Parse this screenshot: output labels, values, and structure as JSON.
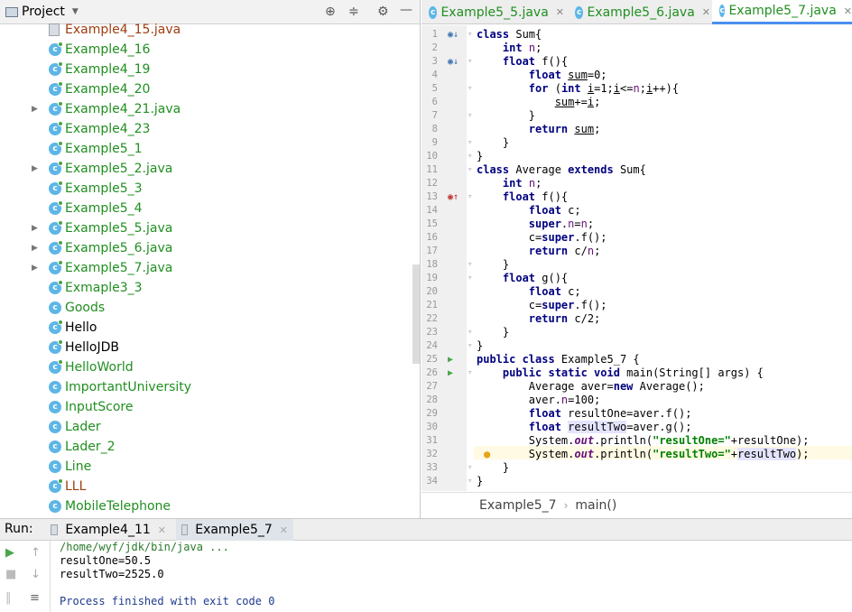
{
  "project": {
    "title": "Project"
  },
  "tree": [
    {
      "label": "Example4_15.java",
      "color": "brown",
      "icon": "file",
      "arrow": false
    },
    {
      "label": "Example4_16",
      "color": "green",
      "icon": "class-run",
      "arrow": false
    },
    {
      "label": "Example4_19",
      "color": "green",
      "icon": "class-run",
      "arrow": false
    },
    {
      "label": "Example4_20",
      "color": "green",
      "icon": "class-run",
      "arrow": false
    },
    {
      "label": "Example4_21.java",
      "color": "green",
      "icon": "class-run",
      "arrow": true
    },
    {
      "label": "Example4_23",
      "color": "green",
      "icon": "class-run",
      "arrow": false
    },
    {
      "label": "Example5_1",
      "color": "green",
      "icon": "class-run",
      "arrow": false
    },
    {
      "label": "Example5_2.java",
      "color": "green",
      "icon": "class-run",
      "arrow": true
    },
    {
      "label": "Example5_3",
      "color": "green",
      "icon": "class-run",
      "arrow": false
    },
    {
      "label": "Example5_4",
      "color": "green",
      "icon": "class-run",
      "arrow": false
    },
    {
      "label": "Example5_5.java",
      "color": "green",
      "icon": "class-run",
      "arrow": true
    },
    {
      "label": "Example5_6.java",
      "color": "green",
      "icon": "class-run",
      "arrow": true
    },
    {
      "label": "Example5_7.java",
      "color": "green",
      "icon": "class-run",
      "arrow": true
    },
    {
      "label": "Exmaple3_3",
      "color": "green",
      "icon": "class-run",
      "arrow": false
    },
    {
      "label": "Goods",
      "color": "green",
      "icon": "class",
      "arrow": false
    },
    {
      "label": "Hello",
      "color": "black",
      "icon": "class-run",
      "arrow": false
    },
    {
      "label": "HelloJDB",
      "color": "black",
      "icon": "class-run",
      "arrow": false
    },
    {
      "label": "HelloWorld",
      "color": "green",
      "icon": "class-run",
      "arrow": false
    },
    {
      "label": "ImportantUniversity",
      "color": "green",
      "icon": "class",
      "arrow": false
    },
    {
      "label": "InputScore",
      "color": "green",
      "icon": "class",
      "arrow": false
    },
    {
      "label": "Lader",
      "color": "green",
      "icon": "class",
      "arrow": false
    },
    {
      "label": "Lader_2",
      "color": "green",
      "icon": "class",
      "arrow": false
    },
    {
      "label": "Line",
      "color": "green",
      "icon": "class",
      "arrow": false
    },
    {
      "label": "LLL",
      "color": "brown",
      "icon": "class-run",
      "arrow": false
    },
    {
      "label": "MobileTelephone",
      "color": "green",
      "icon": "class",
      "arrow": false
    }
  ],
  "tabs": [
    "Example5_5.java",
    "Example5_6.java",
    "Example5_7.java"
  ],
  "code_lines": [
    "<span class=\"kw\">class</span> Sum{",
    "    <span class=\"kw\">int</span> <span class=\"fld\">n</span>;",
    "    <span class=\"kw\">float</span> f(){",
    "        <span class=\"kw\">float</span> <span class=\"ul\">sum</span>=0;",
    "        <span class=\"kw\">for</span> (<span class=\"kw\">int</span> <span class=\"ul\">i</span>=1;<span class=\"ul\">i</span>&lt;=<span class=\"fld\">n</span>;<span class=\"ul\">i</span>++){",
    "            <span class=\"ul\">sum</span>+=<span class=\"ul\">i</span>;",
    "        }",
    "        <span class=\"kw\">return</span> <span class=\"ul\">sum</span>;",
    "    }",
    "}",
    "<span class=\"kw\">class</span> Average <span class=\"kw\">extends</span> Sum{",
    "    <span class=\"kw\">int</span> <span class=\"fld\">n</span>;",
    "    <span class=\"kw\">float</span> f(){",
    "        <span class=\"kw\">float</span> c;",
    "        <span class=\"kw\">super</span>.<span class=\"fld\">n</span>=<span class=\"fld\">n</span>;",
    "        c=<span class=\"kw\">super</span>.f();",
    "        <span class=\"kw\">return</span> c/<span class=\"fld\">n</span>;",
    "    }",
    "    <span class=\"kw\">float</span> g(){",
    "        <span class=\"kw\">float</span> c;",
    "        c=<span class=\"kw\">super</span>.f();",
    "        <span class=\"kw\">return</span> c/2;",
    "    }",
    "}",
    "<span class=\"kw\">public class</span> Example5_7 {",
    "    <span class=\"kw\">public static void</span> main(String[] args) {",
    "        Average aver=<span class=\"kw\">new</span> Average();",
    "        aver.<span class=\"fld\">n</span>=100;",
    "        <span class=\"kw\">float</span> resultOne=aver.f();",
    "        <span class=\"kw\">float</span> <span class=\"hl\">resultTwo</span>=aver.g();",
    "        System.<span class=\"ital\">out</span>.println(<span class=\"str\">\"resultOne=\"</span>+resultOne);",
    "        System.<span class=\"ital\">out</span>.println(<span class=\"str\">\"resultTwo=\"</span>+<span class=\"hl\">resultTwo</span>);",
    "    }",
    "}"
  ],
  "breadcrumb": {
    "cls": "Example5_7",
    "method": "main()"
  },
  "run": {
    "label": "Run:",
    "tabs": [
      "Example4_11",
      "Example5_7"
    ]
  },
  "console": {
    "cmd": "/home/wyf/jdk/bin/java ...",
    "out1": "resultOne=50.5",
    "out2": "resultTwo=2525.0",
    "done": "Process finished with exit code 0"
  }
}
